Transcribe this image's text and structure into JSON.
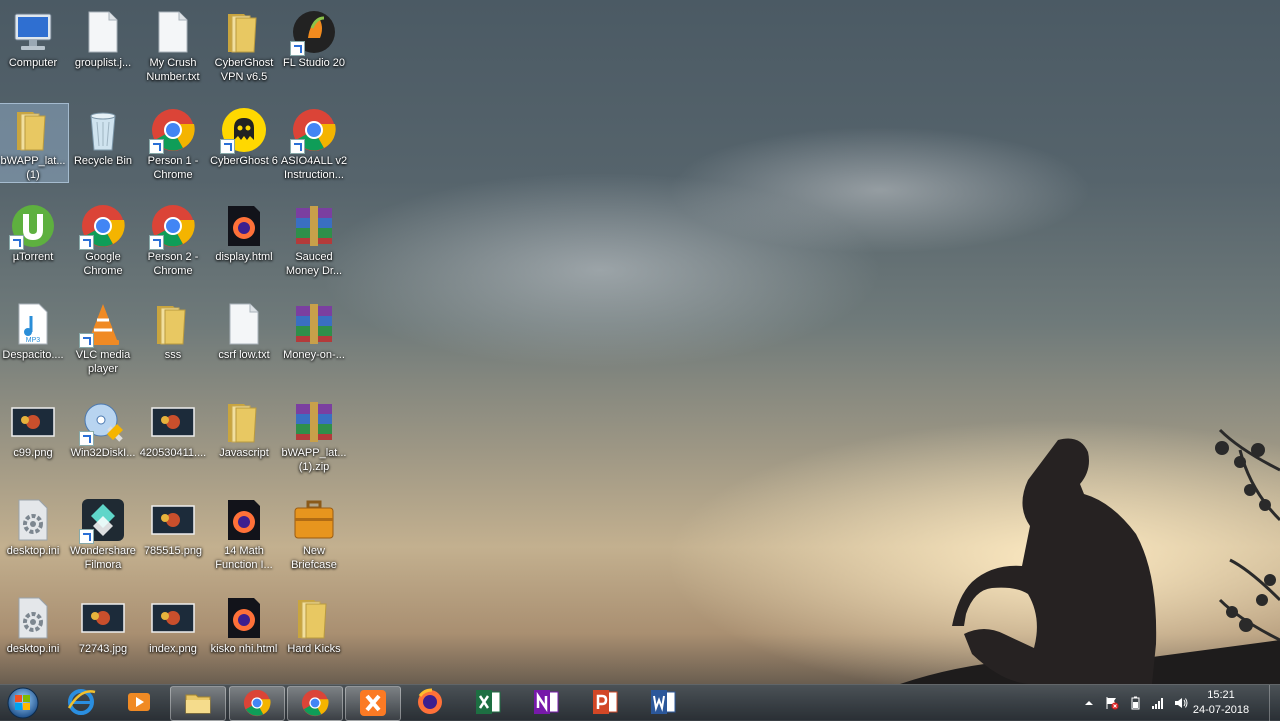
{
  "desktop": {
    "icons": [
      {
        "label": "Computer",
        "icon": "computer-icon"
      },
      {
        "label": "grouplist.j...",
        "icon": "text-file-icon"
      },
      {
        "label": "My Crush Number.txt",
        "icon": "text-file-icon"
      },
      {
        "label": "CyberGhost VPN v6.5",
        "icon": "folder-icon"
      },
      {
        "label": "FL Studio 20",
        "icon": "fl-studio-icon"
      },
      {
        "label": "bWAPP_lat... (1)",
        "icon": "folder-icon"
      },
      {
        "label": "Recycle Bin",
        "icon": "recycle-bin-icon"
      },
      {
        "label": "Person 1 - Chrome",
        "icon": "chrome-icon"
      },
      {
        "label": "CyberGhost 6",
        "icon": "cyberghost-icon"
      },
      {
        "label": "ASIO4ALL v2 Instruction...",
        "icon": "chrome-icon"
      },
      {
        "label": "µTorrent",
        "icon": "utorrent-icon"
      },
      {
        "label": "Google Chrome",
        "icon": "chrome-icon"
      },
      {
        "label": "Person 2 - Chrome",
        "icon": "chrome-icon"
      },
      {
        "label": "display.html",
        "icon": "firefox-html-icon"
      },
      {
        "label": "Sauced Money Dr...",
        "icon": "winrar-icon"
      },
      {
        "label": "Despacito....",
        "icon": "mp3-icon"
      },
      {
        "label": "VLC media player",
        "icon": "vlc-icon"
      },
      {
        "label": "sss",
        "icon": "folder-icon"
      },
      {
        "label": "csrf low.txt",
        "icon": "text-file-icon"
      },
      {
        "label": "Money-on-...",
        "icon": "winrar-icon"
      },
      {
        "label": "c99.png",
        "icon": "image-icon"
      },
      {
        "label": "Win32DiskI...",
        "icon": "win32disk-icon"
      },
      {
        "label": "420530411....",
        "icon": "image-icon"
      },
      {
        "label": "Javascript",
        "icon": "folder-icon"
      },
      {
        "label": "bWAPP_lat... (1).zip",
        "icon": "winrar-icon"
      },
      {
        "label": "desktop.ini",
        "icon": "settings-file-icon"
      },
      {
        "label": "Wondershare Filmora",
        "icon": "filmora-icon"
      },
      {
        "label": "785515.png",
        "icon": "image-icon"
      },
      {
        "label": "14 Math Function I...",
        "icon": "firefox-html-icon"
      },
      {
        "label": "New Briefcase",
        "icon": "briefcase-icon"
      },
      {
        "label": "desktop.ini",
        "icon": "settings-file-icon"
      },
      {
        "label": "72743.jpg",
        "icon": "image-icon"
      },
      {
        "label": "index.png",
        "icon": "image-icon"
      },
      {
        "label": "kisko nhi.html",
        "icon": "firefox-html-icon"
      },
      {
        "label": "Hard Kicks",
        "icon": "folder-icon"
      }
    ]
  },
  "taskbar": {
    "start": "windows-start-icon",
    "apps": [
      {
        "icon": "internet-explorer-icon",
        "open": false
      },
      {
        "icon": "media-player-icon",
        "open": false
      },
      {
        "icon": "file-explorer-icon",
        "open": true
      },
      {
        "icon": "chrome-icon",
        "open": true
      },
      {
        "icon": "chrome-icon",
        "open": true
      },
      {
        "icon": "xampp-icon",
        "open": true
      },
      {
        "icon": "firefox-icon",
        "open": false
      },
      {
        "icon": "excel-icon",
        "open": false
      },
      {
        "icon": "onenote-icon",
        "open": false
      },
      {
        "icon": "powerpoint-icon",
        "open": false
      },
      {
        "icon": "word-icon",
        "open": false
      }
    ],
    "tray": [
      "chevron-up-icon",
      "action-center-flag-icon",
      "battery-icon",
      "network-signal-icon",
      "volume-icon"
    ],
    "clock": {
      "time": "15:21",
      "date": "24-07-2018"
    }
  },
  "colors": {
    "folder": "#e8c862",
    "chrome_red": "#db4437",
    "chrome_green": "#0f9d58",
    "chrome_yellow": "#f4b400",
    "chrome_blue": "#4285f4"
  }
}
